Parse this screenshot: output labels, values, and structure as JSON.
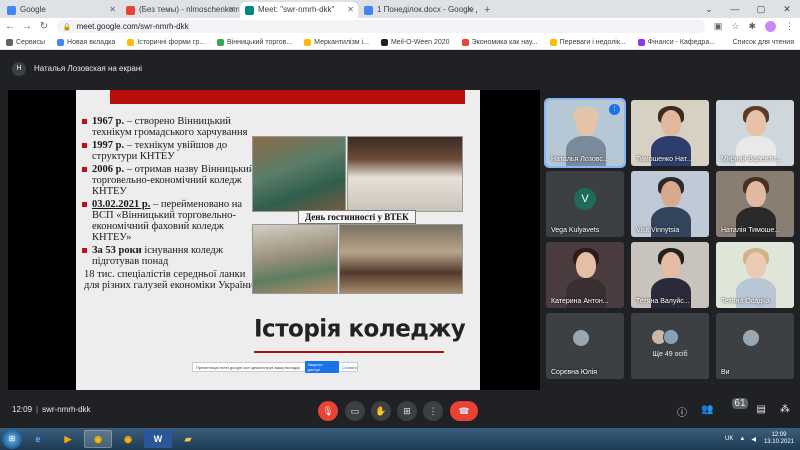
{
  "browser": {
    "tabs": [
      {
        "label": "Google",
        "favicon_color": "#4285f4",
        "active": false
      },
      {
        "label": "(Без темы) - nlmoschenkom@gm",
        "favicon_color": "#ea4335",
        "active": false
      },
      {
        "label": "Meet: \"swr-nmrh-dkk\"",
        "favicon_color": "#00897b",
        "active": true
      },
      {
        "label": "1 Понеділок.docx - Google Диск",
        "favicon_color": "#4285f4",
        "active": false
      }
    ],
    "new_tab": "+",
    "url": "meet.google.com/swr-nmrh-dkk",
    "bookmarks": [
      {
        "label": "Сервисы",
        "color": "#5f6368"
      },
      {
        "label": "Новая вкладка",
        "color": "#4285f4"
      },
      {
        "label": "Історичні форми гр...",
        "color": "#fbbc04"
      },
      {
        "label": "Вінницький торгов...",
        "color": "#34a853"
      },
      {
        "label": "Меркантилізм і...",
        "color": "#fbbc04"
      },
      {
        "label": "Мeil-O-Ween 2020",
        "color": "#202124"
      },
      {
        "label": "Экономика как нау...",
        "color": "#ea4335"
      },
      {
        "label": "Переваги і недолік...",
        "color": "#fbbc04"
      },
      {
        "label": "Фінанси - Кафедра...",
        "color": "#9334e6"
      }
    ],
    "reading_list": "Список для чтения"
  },
  "meet": {
    "presenter_initial": "Н",
    "presenter_label": "Наталья Лозовская на екрані",
    "slide": {
      "bullets": [
        {
          "strong": "1967 р.",
          "text": " – створено Вінницький технікум громадського харчування"
        },
        {
          "strong": "1997 р.",
          "text": " – технікум увійшов до структури КНТЕУ"
        },
        {
          "strong": "2006 р.",
          "text": " – отримав назву Вінницький торговельно-економічний коледж КНТЕУ"
        },
        {
          "strong": "03.02.2021 р.",
          "text": " – перейменовано на ВСП «Вінницький торговельно-економічний фаховий коледж КНТЕУ»"
        },
        {
          "strong": "За 53 роки",
          "text": " існування коледж підготував понад"
        }
      ],
      "last_line": "18 тис. спеціалістів середньої ланки для різних галузей економіки України.",
      "photo_banner": "День гостинності у ВТЕК",
      "photo_sign": "ТОРГОВО-ЕКОНОМІЧНИЙ",
      "title": "Історія коледжу",
      "share_notice": "Презентація meet.google.com демонструє вашу вкладку.",
      "share_stop": "Закрити доступ",
      "share_hide": "Сховати"
    },
    "participants": [
      {
        "name": "Наталья Лозовс...",
        "bg": "#b6c7d6",
        "skin": "#e6c3a8",
        "hair": "#d9c7b0",
        "body": "#7a8a9a",
        "speaking": true
      },
      {
        "name": "Тимошенко Нат...",
        "bg": "#d7d1c4",
        "skin": "#e2b79c",
        "hair": "#3a2a22",
        "body": "#2e3d6b",
        "speaking": false
      },
      {
        "name": "Мирний Валенти...",
        "bg": "#cfd7dc",
        "skin": "#e6c2aa",
        "hair": "#5a3a28",
        "body": "#e9e9e9",
        "speaking": false
      },
      {
        "name": "Vega Kulyavets",
        "bg": "#3c4043",
        "initial": "V",
        "speaking": false
      },
      {
        "name": "Visit Vinnytsia",
        "bg": "#bfcad6",
        "skin": "#d9a98d",
        "hair": "#2b2b2b",
        "body": "#33445c",
        "speaking": false
      },
      {
        "name": "Наталія Тимоше...",
        "bg": "#8a7d72",
        "skin": "#e0b9a0",
        "hair": "#4a3020",
        "body": "#2a2a2a",
        "speaking": false
      },
      {
        "name": "Катерина Антон...",
        "bg": "#4a3c3f",
        "skin": "#e4bfa6",
        "hair": "#2a1e1a",
        "body": "#3a2f30",
        "speaking": false
      },
      {
        "name": "Тетяна Валуйс...",
        "bg": "#c9c3bd",
        "skin": "#e3bca3",
        "hair": "#222222",
        "body": "#2a2a3a",
        "speaking": false
      },
      {
        "name": "Тетяна Осадча",
        "bg": "#dfe6d8",
        "skin": "#ecc9b2",
        "hair": "#cfb48a",
        "body": "#b9c7d4",
        "speaking": false
      },
      {
        "name": "Сорєвна Юлія",
        "bg": "#3c4043",
        "speaking": false
      },
      {
        "name": "",
        "bg": "#3c4043",
        "more": "Ще 49 осіб",
        "speaking": false
      },
      {
        "name": "Ви",
        "bg": "#3c4043",
        "speaking": false
      }
    ],
    "controls": {
      "time": "12:09",
      "meeting_code": "swr-nmrh-dkk",
      "people_count": "61"
    }
  },
  "taskbar": {
    "language": "UK",
    "time": "12:09",
    "date": "13.10.2021"
  }
}
